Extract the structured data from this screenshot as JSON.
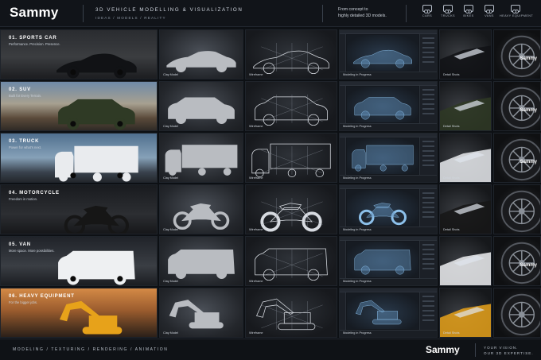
{
  "header": {
    "brand": "Sammy",
    "subtitle": "3D VEHICLE MODELLING & VISUALIZATION",
    "subnav": "IDEAS / MODELS / REALITY",
    "tagline_1": "From concept to",
    "tagline_2": "highly detailed 3D models.",
    "categories": [
      {
        "label": "CARS",
        "icon": "car-icon"
      },
      {
        "label": "TRUCKS",
        "icon": "truck-icon"
      },
      {
        "label": "BIKES",
        "icon": "bike-icon"
      },
      {
        "label": "VANS",
        "icon": "van-icon"
      },
      {
        "label": "HEAVY EQUIPMENT",
        "icon": "excavator-icon"
      }
    ]
  },
  "rows": [
    {
      "title": "01.  SPORTS CAR",
      "tagline": "Performance. Precision. Presence.",
      "clay": "Clay Model",
      "wire": "Wireframe",
      "progress": "Modeling in Progress",
      "detail": "Detail Shots",
      "badge": "Sammy"
    },
    {
      "title": "02.  SUV",
      "tagline": "Built for Every Terrain.",
      "clay": "Clay Model",
      "wire": "Wireframe",
      "progress": "Modeling in Progress",
      "detail": "Detail Shots",
      "badge": "Sammy"
    },
    {
      "title": "03.  TRUCK",
      "tagline": "Power for what's next.",
      "clay": "Clay Model",
      "wire": "Wireframe",
      "progress": "Modeling in Progress",
      "detail": "Detail Shots",
      "badge": "Sammy"
    },
    {
      "title": "04.  MOTORCYCLE",
      "tagline": "Freedom in motion.",
      "clay": "Clay Model",
      "wire": "Wireframe",
      "progress": "Modeling in Progress",
      "detail": "Detail Shots",
      "badge": ""
    },
    {
      "title": "05.  VAN",
      "tagline": "More space. More possibilities.",
      "clay": "Clay Model",
      "wire": "Wireframe",
      "progress": "Modeling in Progress",
      "detail": "Detail Shots",
      "badge": "Sammy"
    },
    {
      "title": "06.  HEAVY EQUIPMENT",
      "tagline": "For the bigger jobs.",
      "clay": "Clay Model",
      "wire": "Wireframe",
      "progress": "Modeling in Progress",
      "detail": "Detail Shots",
      "badge": ""
    }
  ],
  "footer": {
    "nav": "MODELING  /  TEXTURING  /  RENDERING  /  ANIMATION",
    "brand": "Sammy",
    "tag_1": "YOUR VISION.",
    "tag_2": "OUR 3D EXPERTISE."
  }
}
